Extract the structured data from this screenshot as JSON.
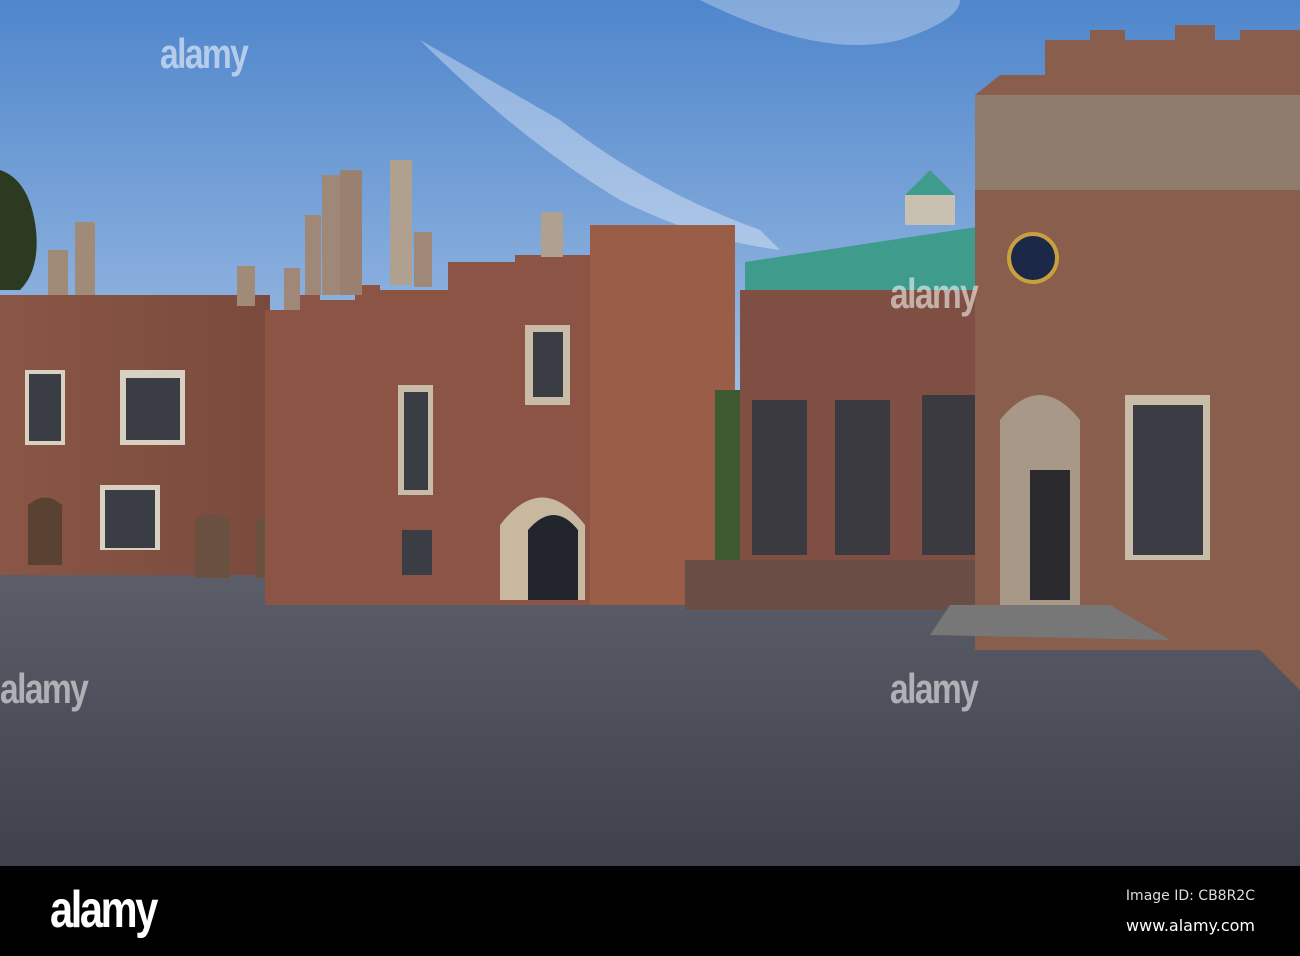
{
  "watermark": {
    "text": "alamy"
  },
  "footer": {
    "logo": "alamy",
    "image_id": "Image ID: CB8R2C",
    "site": "www.alamy.com"
  },
  "colors": {
    "sky_top": "#4f86cc",
    "sky_bottom": "#c6d9ee",
    "stone": "#8c5b4a",
    "roof": "#3f9c8c",
    "ground": "#4a4d58"
  }
}
